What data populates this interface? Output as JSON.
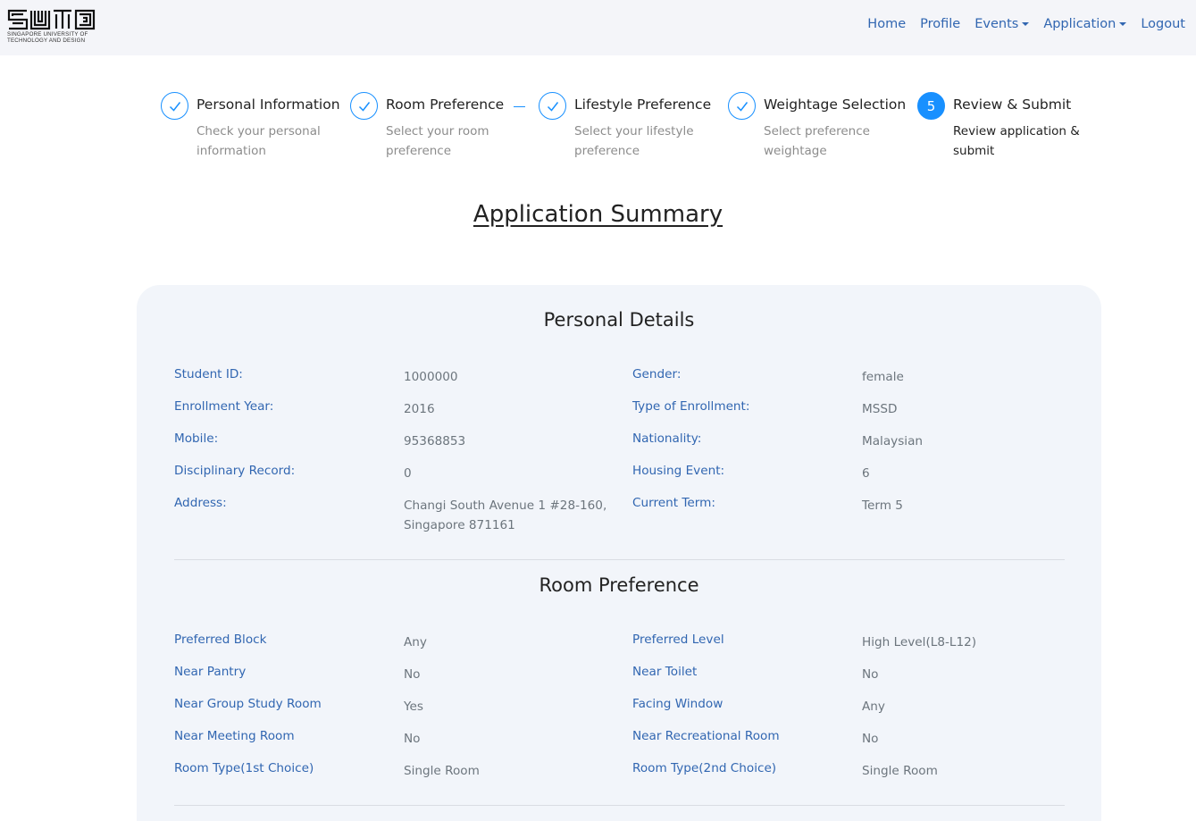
{
  "brand": {
    "logo_text": "SUTD",
    "subtitle_line1": "SINGAPORE UNIVERSITY OF",
    "subtitle_line2": "TECHNOLOGY AND DESIGN"
  },
  "nav": {
    "items": [
      {
        "label": "Home",
        "dropdown": false
      },
      {
        "label": "Profile",
        "dropdown": false
      },
      {
        "label": "Events",
        "dropdown": true
      },
      {
        "label": "Application",
        "dropdown": true
      },
      {
        "label": "Logout",
        "dropdown": false
      }
    ]
  },
  "steps": [
    {
      "title": "Personal Information",
      "desc": "Check your personal information",
      "status": "finished",
      "icon": "check-icon"
    },
    {
      "title": "Room Preference",
      "desc": "Select your room preference",
      "status": "finished",
      "icon": "check-icon"
    },
    {
      "title": "Lifestyle Preference",
      "desc": "Select your lifestyle preference",
      "status": "finished",
      "icon": "check-icon"
    },
    {
      "title": "Weightage Selection",
      "desc": "Select preference weightage",
      "status": "finished",
      "icon": "check-icon"
    },
    {
      "title": "Review & Submit",
      "desc": "Review application & submit",
      "status": "active",
      "number": "5"
    }
  ],
  "summary_title": "Application Summary",
  "personal": {
    "title": "Personal Details",
    "rows": [
      {
        "l1": "Student ID:",
        "v1": "1000000",
        "l2": "Gender:",
        "v2": "female"
      },
      {
        "l1": "Enrollment Year:",
        "v1": "2016",
        "l2": "Type of Enrollment:",
        "v2": "MSSD"
      },
      {
        "l1": "Mobile:",
        "v1": "95368853",
        "l2": "Nationality:",
        "v2": "Malaysian"
      },
      {
        "l1": "Disciplinary Record:",
        "v1": "0",
        "l2": "Housing Event:",
        "v2": "6"
      },
      {
        "l1": "Address:",
        "v1": "Changi South Avenue 1 #28-160, Singapore 871161",
        "l2": "Current Term:",
        "v2": "Term 5"
      }
    ]
  },
  "room": {
    "title": "Room Preference",
    "rows": [
      {
        "l1": "Preferred Block",
        "v1": "Any",
        "l2": "Preferred Level",
        "v2": "High Level(L8-L12)"
      },
      {
        "l1": "Near Pantry",
        "v1": "No",
        "l2": "Near Toilet",
        "v2": "No"
      },
      {
        "l1": "Near Group Study Room",
        "v1": "Yes",
        "l2": "Facing Window",
        "v2": "Any"
      },
      {
        "l1": "Near Meeting Room",
        "v1": "No",
        "l2": "Near Recreational Room",
        "v2": "No"
      },
      {
        "l1": "Room Type(1st Choice)",
        "v1": "Single Room",
        "l2": "Room Type(2nd Choice)",
        "v2": "Single Room"
      }
    ]
  },
  "colors": {
    "primary": "#1890ff",
    "label": "#3166b1",
    "value": "#6c757d",
    "card_bg": "#f2f5fa",
    "navbar_bg": "#f4f5f9"
  }
}
